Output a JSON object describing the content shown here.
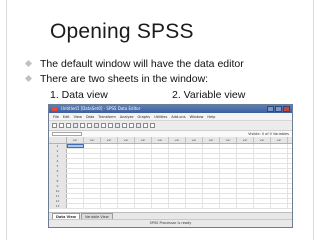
{
  "slide": {
    "title": "Opening SPSS",
    "bullets": [
      "The default window will have the data editor",
      "There are two sheets in the window:"
    ],
    "sheet_list": {
      "first": "1. Data view",
      "second": "2.  Variable view"
    }
  },
  "spss_window": {
    "title": "Untitled1 [DataSet0] - SPSS Data Editor",
    "menu": [
      "File",
      "Edit",
      "View",
      "Data",
      "Transform",
      "Analyze",
      "Graphs",
      "Utilities",
      "Add-ons",
      "Window",
      "Help"
    ],
    "visible_vars_text": "Visible: 0 of 0 Variables",
    "column_header": "var",
    "row_numbers": [
      "1",
      "2",
      "3",
      "4",
      "5",
      "6",
      "7",
      "8",
      "9",
      "10",
      "11",
      "12",
      "13"
    ],
    "tabs": {
      "data_view": "Data View",
      "variable_view": "Variable View"
    },
    "status": "SPSS Processor is ready"
  }
}
